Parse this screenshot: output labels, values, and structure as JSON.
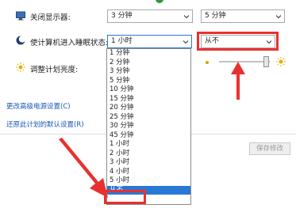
{
  "settings": {
    "display_off": {
      "label": "关闭显示器:",
      "battery_value": "3 分钟",
      "plugged_value": "5 分钟"
    },
    "sleep": {
      "label": "使计算机进入睡眠状态:",
      "battery_value": "1 小时",
      "plugged_value": "从不"
    },
    "brightness": {
      "label": "调整计划亮度:",
      "level_fraction": 0.9
    }
  },
  "links": {
    "advanced": "更改高级电源设置(C)",
    "restore": "还原此计划的默认设置(R)"
  },
  "dropdown": {
    "options": [
      "1 分钟",
      "2 分钟",
      "3 分钟",
      "5 分钟",
      "10 分钟",
      "15 分钟",
      "20 分钟",
      "25 分钟",
      "30 分钟",
      "45 分钟",
      "1 小时",
      "2 小时",
      "3 小时",
      "4 小时",
      "5 小时",
      "从不"
    ],
    "selected_index": 15
  },
  "buttons": {
    "save": "保存修改"
  },
  "colors": {
    "annotation_red": "#e8312f",
    "selection_blue": "#2a78d6"
  }
}
